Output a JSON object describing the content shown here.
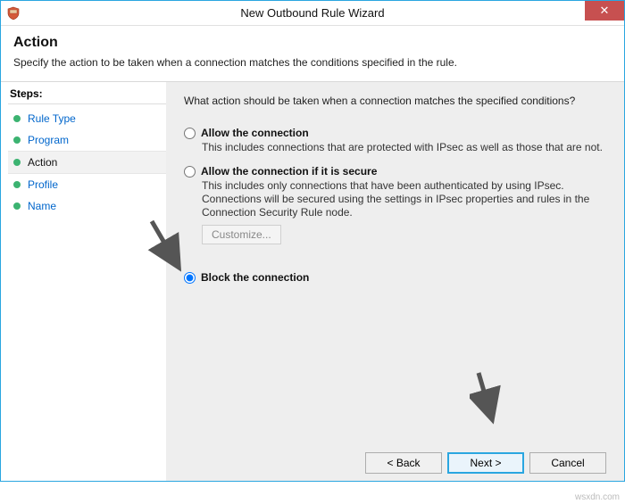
{
  "window": {
    "title": "New Outbound Rule Wizard"
  },
  "header": {
    "title": "Action",
    "subtitle": "Specify the action to be taken when a connection matches the conditions specified in the rule."
  },
  "sidebar": {
    "steps_label": "Steps:",
    "items": [
      {
        "label": "Rule Type",
        "current": false
      },
      {
        "label": "Program",
        "current": false
      },
      {
        "label": "Action",
        "current": true
      },
      {
        "label": "Profile",
        "current": false
      },
      {
        "label": "Name",
        "current": false
      }
    ]
  },
  "main": {
    "question": "What action should be taken when a connection matches the specified conditions?",
    "options": [
      {
        "key": "allow",
        "label": "Allow the connection",
        "desc": "This includes connections that are protected with IPsec as well as those that are not.",
        "selected": false
      },
      {
        "key": "allow-secure",
        "label": "Allow the connection if it is secure",
        "desc": "This includes only connections that have been authenticated by using IPsec. Connections will be secured using the settings in IPsec properties and rules in the Connection Security Rule node.",
        "selected": false,
        "customize_label": "Customize..."
      },
      {
        "key": "block",
        "label": "Block the connection",
        "desc": "",
        "selected": true
      }
    ]
  },
  "footer": {
    "back": "< Back",
    "next": "Next >",
    "cancel": "Cancel"
  },
  "watermark": "wsxdn.com"
}
